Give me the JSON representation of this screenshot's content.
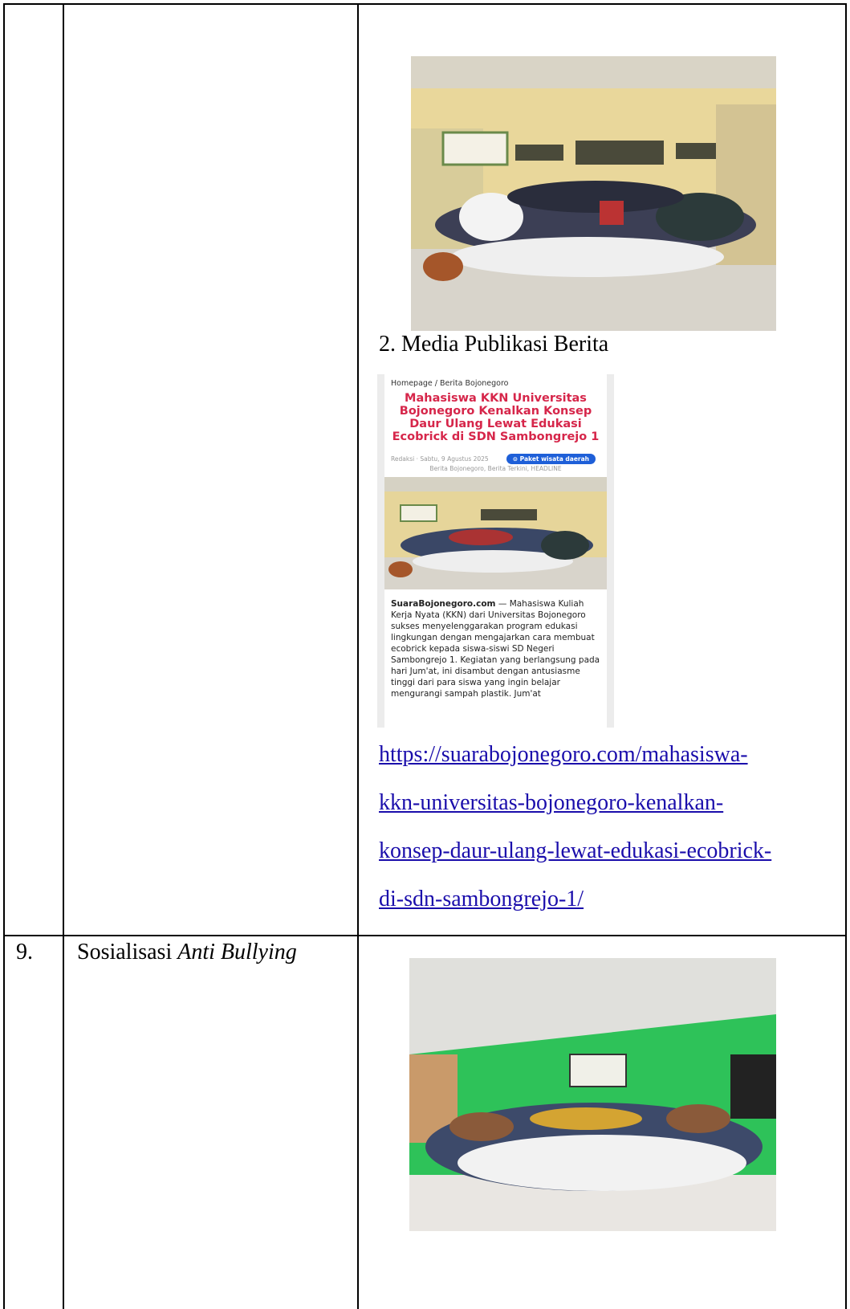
{
  "rows": [
    {
      "number": "",
      "activity": "",
      "caption": "2. Media Publikasi Berita",
      "article": {
        "breadcrumb": "Homepage / Berita Bojonegoro",
        "headline": "Mahasiswa KKN Universitas Bojonegoro Kenalkan Konsep Daur Ulang Lewat Edukasi Ecobrick di SDN Sambongrejo 1",
        "meta": "Redaksi · Sabtu, 9 Agustus 2025",
        "pill": "⊙ Paket wisata daerah",
        "categories": "Berita Bojonegoro, Berita Terkini, HEADLINE",
        "source": "SuaraBojonegoro.com",
        "body": " — Mahasiswa Kuliah Kerja Nyata (KKN) dari Universitas Bojonegoro sukses menyelenggarakan program edukasi lingkungan dengan mengajarkan cara membuat ecobrick kepada siswa-siswi SD Negeri Sambongrejo 1. Kegiatan yang berlangsung pada hari Jum'at, ini disambut dengan antusiasme tinggi dari para siswa yang ingin belajar mengurangi sampah plastik. Jum'at"
      },
      "link_lines": [
        "https://suarabojonegoro.com/mahasiswa-",
        "kkn-universitas-bojonegoro-kenalkan-",
        "konsep-daur-ulang-lewat-edukasi-ecobrick-",
        "di-sdn-sambongrejo-1/"
      ]
    },
    {
      "number": "9.",
      "activity_plain": "Sosialisasi ",
      "activity_italic": "Anti Bullying"
    }
  ],
  "colors": {
    "link": "#1a0dab",
    "headline": "#d6264a",
    "pill": "#1e5fd8"
  }
}
